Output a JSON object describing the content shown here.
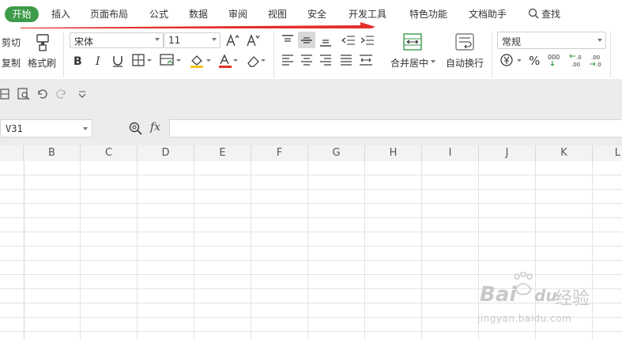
{
  "menu": {
    "active_tab": "开始",
    "tabs": [
      "插入",
      "页面布局",
      "公式",
      "数据",
      "审阅",
      "视图",
      "安全",
      "开发工具",
      "特色功能",
      "文档助手"
    ],
    "search_label": "查找"
  },
  "ribbon": {
    "cut_label": "剪切",
    "copy_label": "复制",
    "format_painter_label": "格式刷",
    "font_name": "宋体",
    "font_size": "11",
    "merge_center_label": "合并居中",
    "wrap_text_label": "自动换行",
    "number_format": "常规"
  },
  "formula_bar": {
    "cell_ref": "V31",
    "fx_label": "fx",
    "formula_value": ""
  },
  "sheet": {
    "columns": [
      "B",
      "C",
      "D",
      "E",
      "F",
      "G",
      "H",
      "I",
      "J",
      "K",
      "L"
    ]
  },
  "watermark": {
    "brand": "Bai",
    "brand2": "du",
    "jingyan": "经验",
    "url": "jingyan.baidu.com"
  },
  "colors": {
    "active_tab": "#3c9b4a",
    "arrow": "#e3302a",
    "toolbar_bg": "#ececec"
  }
}
